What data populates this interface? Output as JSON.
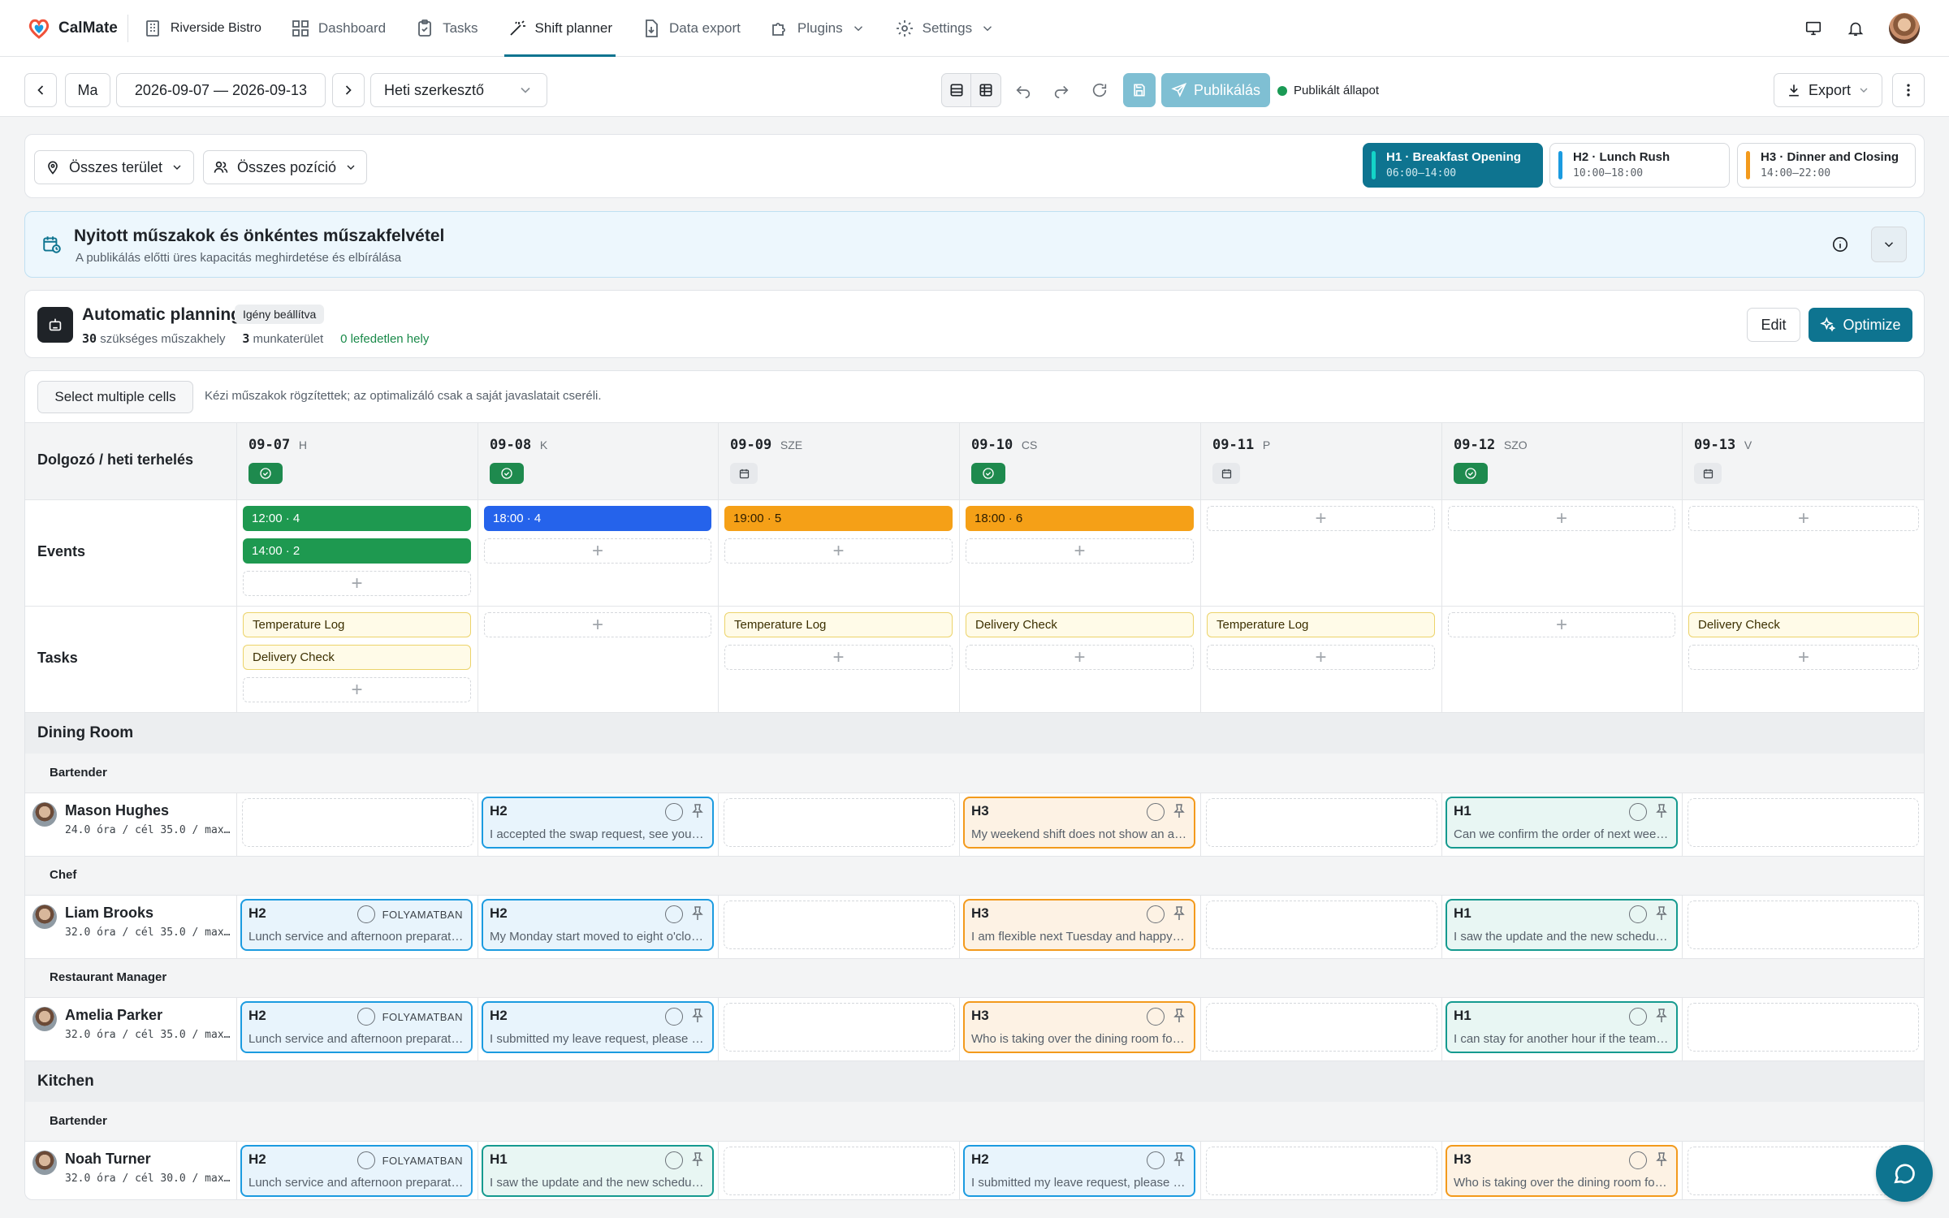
{
  "app": {
    "name": "CalMate",
    "venue": "Riverside Bistro"
  },
  "nav": [
    {
      "label": "Dashboard",
      "icon": "dashboard-icon"
    },
    {
      "label": "Tasks",
      "icon": "clipboard-icon"
    },
    {
      "label": "Shift planner",
      "icon": "magic-wand-icon",
      "active": true
    },
    {
      "label": "Data export",
      "icon": "file-download-icon"
    },
    {
      "label": "Plugins",
      "icon": "puzzle-icon"
    },
    {
      "label": "Settings",
      "icon": "gear-icon"
    }
  ],
  "toolbar": {
    "today": "Ma",
    "date_range": "2026-09-07 — 2026-09-13",
    "view_select": "Heti szerkesztő",
    "publish": "Publikálás",
    "status": "Publikált állapot",
    "export": "Export"
  },
  "filters": {
    "area": "Összes terület",
    "position": "Összes pozíció"
  },
  "shift_types": [
    {
      "code": "H1",
      "name": "Breakfast Opening",
      "time": "06:00–14:00",
      "color": "#14a4b8",
      "selected": true
    },
    {
      "code": "H2",
      "name": "Lunch Rush",
      "time": "10:00–18:00",
      "color": "#1b9be0"
    },
    {
      "code": "H3",
      "name": "Dinner and Closing",
      "time": "14:00–22:00",
      "color": "#f39a1c"
    }
  ],
  "open_shifts": {
    "title": "Nyitott műszakok és önkéntes műszakfelvétel",
    "subtitle": "A publikálás előtti üres kapacitás meghirdetése és elbírálása"
  },
  "auto_planning": {
    "title": "Automatic planning",
    "badge": "Igény beállítva",
    "required_count": "30",
    "required_label": "szükséges műszakhely",
    "areas_count": "3",
    "areas_label": "munkaterület",
    "uncovered": "0 lefedetlen hely",
    "edit": "Edit",
    "optimize": "Optimize"
  },
  "grid": {
    "select_multiple": "Select multiple cells",
    "hint": "Kézi műszakok rögzítettek; az optimalizáló csak a saját javaslatait cseréli.",
    "corner": "Dolgozó / heti terhelés",
    "events_label": "Events",
    "tasks_label": "Tasks",
    "days": [
      {
        "date": "09-07",
        "dow": "H",
        "status": "ok"
      },
      {
        "date": "09-08",
        "dow": "K",
        "status": "ok"
      },
      {
        "date": "09-09",
        "dow": "SZE",
        "status": "cal"
      },
      {
        "date": "09-10",
        "dow": "CS",
        "status": "ok"
      },
      {
        "date": "09-11",
        "dow": "P",
        "status": "cal"
      },
      {
        "date": "09-12",
        "dow": "SZO",
        "status": "ok"
      },
      {
        "date": "09-13",
        "dow": "V",
        "status": "cal"
      }
    ],
    "events": [
      [
        {
          "label": "12:00 · 4",
          "color": "#1e9950"
        },
        {
          "label": "14:00 · 2",
          "color": "#1e9950"
        }
      ],
      [
        {
          "label": "18:00 · 4",
          "color": "#2563eb"
        }
      ],
      [
        {
          "label": "19:00 · 5",
          "color": "#f5a017"
        }
      ],
      [
        {
          "label": "18:00 · 6",
          "color": "#f5a017"
        }
      ],
      [],
      [],
      []
    ],
    "tasks": [
      [
        "Temperature Log",
        "Delivery Check"
      ],
      [],
      [
        "Temperature Log"
      ],
      [
        "Delivery Check"
      ],
      [
        "Temperature Log"
      ],
      [],
      [
        "Delivery Check"
      ]
    ],
    "in_progress_label": "FOLYAMATBAN",
    "groups": [
      {
        "area": "Dining Room",
        "roles": [
          {
            "role": "Bartender",
            "people": [
              {
                "name": "Mason Hughes",
                "meta": "24.0 óra / cél 35.0 / max…",
                "shifts": [
                  null,
                  {
                    "code": "H2",
                    "note": "I accepted the swap request, see you …"
                  },
                  null,
                  {
                    "code": "H3",
                    "note": "My weekend shift does not show an a…"
                  },
                  null,
                  {
                    "code": "H1",
                    "note": "Can we confirm the order of next wee…"
                  },
                  null
                ]
              }
            ]
          },
          {
            "role": "Chef",
            "people": [
              {
                "name": "Liam Brooks",
                "meta": "32.0 óra / cél 35.0 / max…",
                "shifts": [
                  {
                    "code": "H2",
                    "note": "Lunch service and afternoon preparat…",
                    "progress": true
                  },
                  {
                    "code": "H2",
                    "note": "My Monday start moved to eight o'clo…"
                  },
                  null,
                  {
                    "code": "H3",
                    "note": "I am flexible next Tuesday and happy t…"
                  },
                  null,
                  {
                    "code": "H1",
                    "note": "I saw the update and the new schedul…"
                  },
                  null
                ]
              }
            ]
          },
          {
            "role": "Restaurant Manager",
            "people": [
              {
                "name": "Amelia Parker",
                "meta": "32.0 óra / cél 35.0 / max…",
                "shifts": [
                  {
                    "code": "H2",
                    "note": "Lunch service and afternoon preparat…",
                    "progress": true
                  },
                  {
                    "code": "H2",
                    "note": "I submitted my leave request, please r…"
                  },
                  null,
                  {
                    "code": "H3",
                    "note": "Who is taking over the dining room fo…"
                  },
                  null,
                  {
                    "code": "H1",
                    "note": "I can stay for another hour if the team …"
                  },
                  null
                ]
              }
            ]
          }
        ]
      },
      {
        "area": "Kitchen",
        "roles": [
          {
            "role": "Bartender",
            "people": [
              {
                "name": "Noah Turner",
                "meta": "32.0 óra / cél 30.0 / max…",
                "shifts": [
                  {
                    "code": "H2",
                    "note": "Lunch service and afternoon preparat…",
                    "progress": true
                  },
                  {
                    "code": "H1",
                    "note": "I saw the update and the new schedul…"
                  },
                  null,
                  {
                    "code": "H2",
                    "note": "I submitted my leave request, please r…"
                  },
                  null,
                  {
                    "code": "H3",
                    "note": "Who is taking over the dining room fo…"
                  },
                  null
                ]
              }
            ]
          }
        ]
      }
    ]
  },
  "colors": {
    "accent": "#0e7490",
    "h1_border": "#159a8f",
    "h1_bg": "#e8f6f3",
    "h2_border": "#1b9be0",
    "h2_bg": "#e8f4fc",
    "h3_border": "#f39a1c",
    "h3_bg": "#fdf2e4"
  }
}
